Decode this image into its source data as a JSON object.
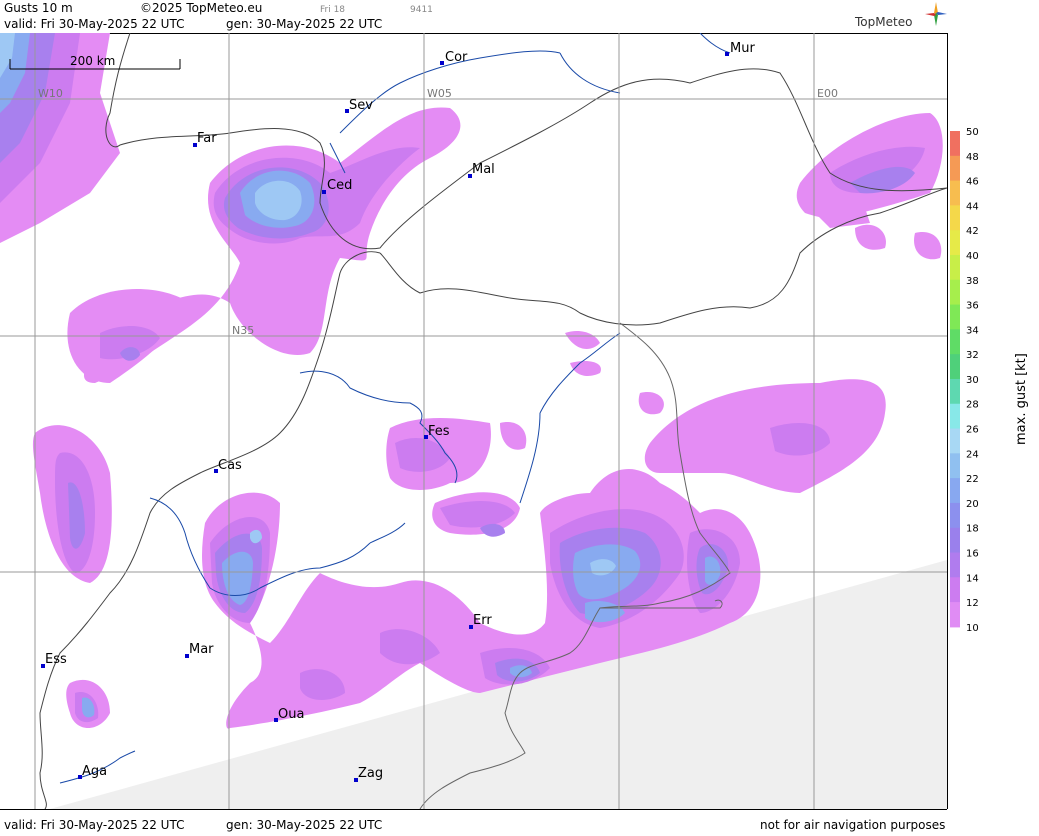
{
  "header": {
    "product": "Gusts 10 m",
    "copyright": "©2025 TopMeteo.eu",
    "day_mark": "Fri 18",
    "code": "9411",
    "valid": "valid:  Fri  30-May-2025  22 UTC",
    "gen": "gen: 30-May-2025 22 UTC",
    "brand": "TopMeteo"
  },
  "footer": {
    "valid": "valid:  Fri  30-May-2025  22 UTC",
    "gen": "gen: 30-May-2025 22 UTC",
    "disclaimer": "not for air navigation purposes"
  },
  "scale_bar": {
    "label": "200 km"
  },
  "grid_labels": {
    "w10": "W10",
    "w05": "W05",
    "e00": "E00",
    "n35": "N35"
  },
  "cities": [
    {
      "name": "Cor"
    },
    {
      "name": "Mur"
    },
    {
      "name": "Sev"
    },
    {
      "name": "Far"
    },
    {
      "name": "Ced"
    },
    {
      "name": "Mal"
    },
    {
      "name": "Fes"
    },
    {
      "name": "Cas"
    },
    {
      "name": "Err"
    },
    {
      "name": "Ess"
    },
    {
      "name": "Mar"
    },
    {
      "name": "Oua"
    },
    {
      "name": "Aga"
    },
    {
      "name": "Zag"
    }
  ],
  "legend": {
    "title": "max. gust [kt]",
    "ticks": [
      "50",
      "48",
      "46",
      "44",
      "42",
      "40",
      "38",
      "36",
      "34",
      "32",
      "30",
      "28",
      "26",
      "24",
      "22",
      "20",
      "18",
      "16",
      "14",
      "12",
      "10"
    ],
    "colors": [
      "#f07060",
      "#f59a55",
      "#f7bd4f",
      "#f4d84a",
      "#e6ea48",
      "#c8ee48",
      "#a6ee4c",
      "#7fe856",
      "#5fdc66",
      "#4fd07a",
      "#5ed8b0",
      "#88e8e8",
      "#a8d8f4",
      "#90c0f0",
      "#88a8f0",
      "#8c90ee",
      "#9a80ec",
      "#b07cee",
      "#cc7cf0",
      "#e08cf4"
    ]
  },
  "colors": {
    "gust_12": "#e48cf4",
    "gust_14": "#cc7cf0",
    "gust_16": "#a880ee",
    "gust_18": "#8c90ee",
    "gust_20": "#88aaf0",
    "gust_22": "#9ec8f4"
  }
}
